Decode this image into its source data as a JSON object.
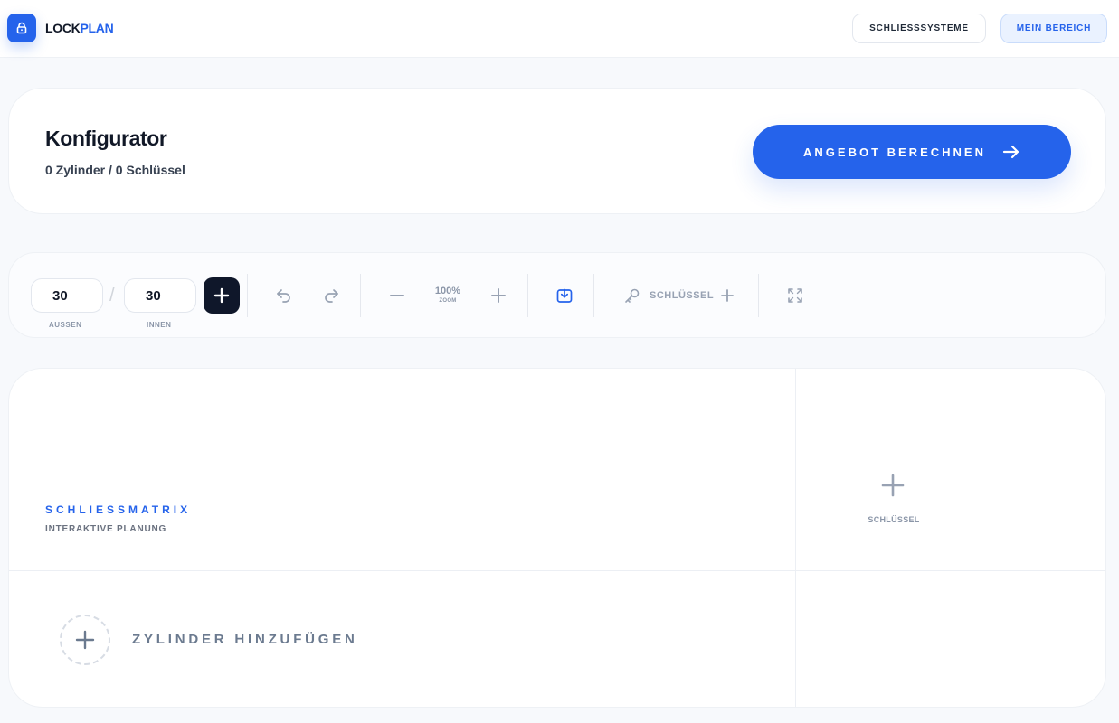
{
  "header": {
    "logo_part1": "LOCK",
    "logo_part2": "PLAN",
    "nav_systems": "SCHLIESSSYSTEME",
    "nav_account": "MEIN BEREICH"
  },
  "hero": {
    "title": "Konfigurator",
    "subtitle": "0 Zylinder / 0 Schlüssel",
    "cta_label": "ANGEBOT BERECHNEN"
  },
  "toolbar": {
    "outer_value": "30",
    "outer_label": "AUSSEN",
    "separator": "/",
    "inner_value": "30",
    "inner_label": "INNEN",
    "zoom_value": "100%",
    "zoom_label": "ZOOM",
    "key_label": "SCHLÜSSEL"
  },
  "matrix": {
    "title": "SCHLIESSMATRIX",
    "subtitle": "INTERAKTIVE PLANUNG",
    "add_key_label": "SCHLÜSSEL",
    "add_cylinder_label": "ZYLINDER HINZUFÜGEN"
  },
  "colors": {
    "accent": "#2563eb",
    "dark": "#0f172a",
    "muted": "#8b96a8",
    "background": "#f7f9fc"
  },
  "icons": [
    "lock-icon",
    "arrow-right-icon",
    "plus-icon",
    "undo-icon",
    "redo-icon",
    "minus-icon",
    "download-icon",
    "key-icon",
    "fullscreen-icon"
  ]
}
